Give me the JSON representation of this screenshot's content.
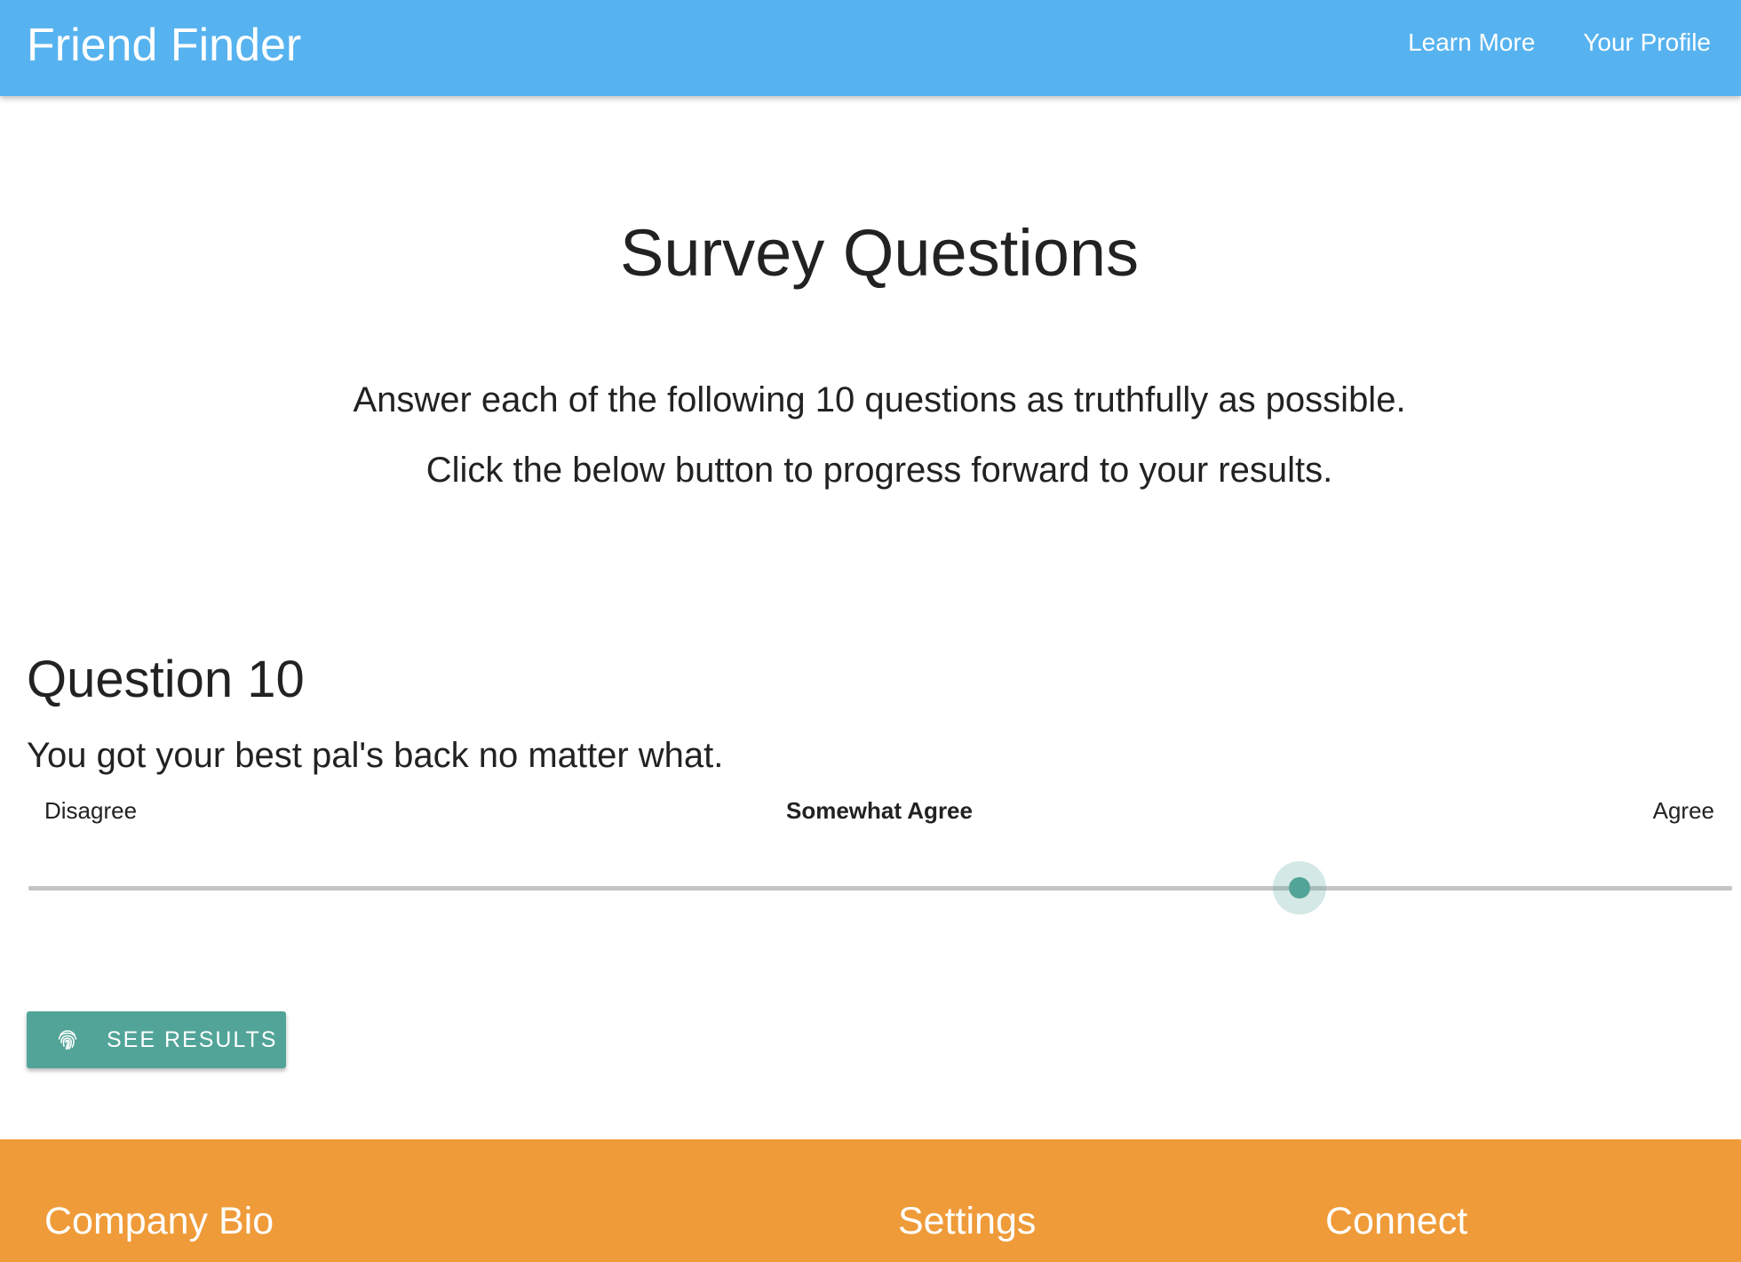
{
  "navbar": {
    "brand": "Friend Finder",
    "links": [
      "Learn More",
      "Your Profile"
    ]
  },
  "survey": {
    "title": "Survey Questions",
    "intro_line_1": "Answer each of the following 10 questions as truthfully as possible.",
    "intro_line_2": "Click the below button to progress forward to your results."
  },
  "question": {
    "heading": "Question 10",
    "text": "You got your best pal's back no matter what.",
    "scale": {
      "min_label": "Disagree",
      "current_label": "Somewhat Agree",
      "max_label": "Agree",
      "value_fraction": 0.746
    }
  },
  "button": {
    "label": "SEE RESULTS",
    "icon": "fingerprint-icon"
  },
  "footer": {
    "headings": [
      "Company Bio",
      "Settings",
      "Connect"
    ]
  },
  "colors": {
    "navbar": "#57b3f0",
    "accent": "#52a498",
    "footer": "#ef9b39"
  }
}
